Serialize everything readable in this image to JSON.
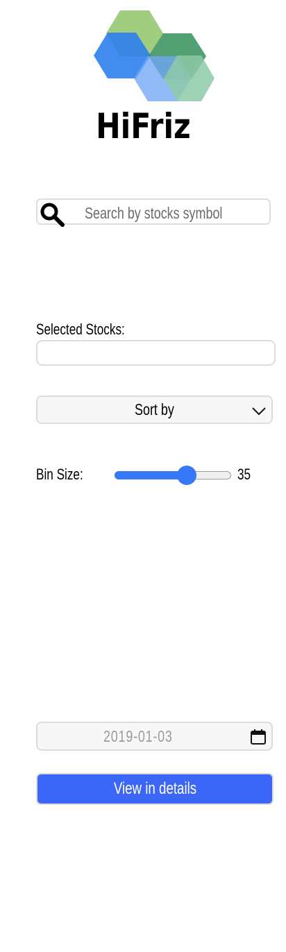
{
  "app": {
    "brand_name": "HiFriz"
  },
  "search": {
    "placeholder": "Search by stocks symbol",
    "value": ""
  },
  "selected_stocks": {
    "label": "Selected Stocks:",
    "value": ""
  },
  "sort": {
    "selected_label": "Sort by"
  },
  "bin_size": {
    "label": "Bin Size:",
    "value": "35",
    "slider_fraction": 0.64
  },
  "date": {
    "value": "2019-01-03"
  },
  "actions": {
    "view_details_label": "View in details"
  },
  "colors": {
    "accent": "#3478f6",
    "button": "#3c66f6",
    "logo_green_light": "#8fc46a",
    "logo_green_dark": "#2e8b57",
    "logo_blue": "#2f80ed",
    "logo_mint": "#8ec9a8"
  },
  "icons": {
    "logo": "hexagon-cluster-logo",
    "search": "search-icon",
    "dropdown": "chevron-down-icon",
    "date": "calendar-icon"
  }
}
